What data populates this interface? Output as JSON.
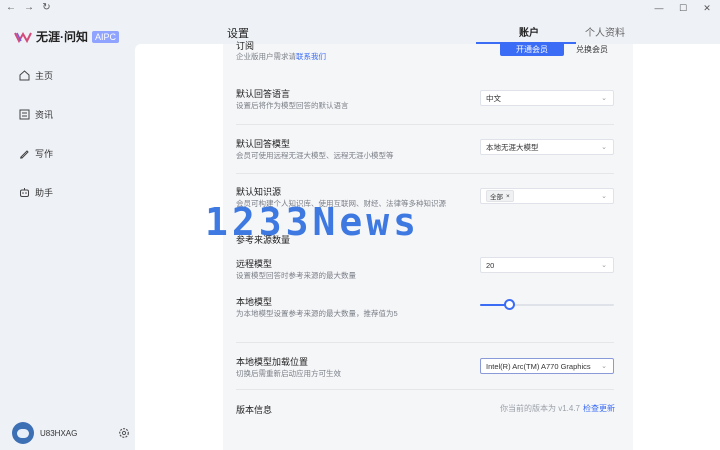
{
  "titlebar": {
    "back_icon": "arrow-left-icon",
    "forward_icon": "arrow-right-icon",
    "refresh_icon": "refresh-icon",
    "minimize": "—",
    "maximize": "☐",
    "close": "✕"
  },
  "sidebar": {
    "logo_text": "无涯·问知",
    "logo_badge": "AIPC",
    "items": [
      {
        "label": "主页",
        "icon": "home-icon"
      },
      {
        "label": "资讯",
        "icon": "news-icon"
      },
      {
        "label": "写作",
        "icon": "pen-icon"
      },
      {
        "label": "助手",
        "icon": "robot-icon"
      }
    ],
    "user": {
      "name": "U83HXAG",
      "settings_icon": "gear-icon"
    }
  },
  "header": {
    "title": "设置",
    "tabs": [
      {
        "label": "账户",
        "active": true
      },
      {
        "label": "个人资料",
        "active": false
      }
    ]
  },
  "settings": {
    "account": {
      "title_partial": "订阅",
      "desc": "企业版用户需求请",
      "link": "联系我们",
      "primary_button": "开通会员",
      "secondary_button": "兑换会员"
    },
    "answer_language": {
      "label": "默认回答语言",
      "desc": "设置后将作为模型回答的默认语言",
      "value": "中文"
    },
    "answer_model": {
      "label": "默认回答模型",
      "desc": "会员可使用远程无涯大模型、远程无涯小模型等",
      "value": "本地无涯大模型"
    },
    "knowledge_source": {
      "label": "默认知识源",
      "desc": "会员可构建个人知识库、使用互联网、财经、法律等多种知识源",
      "chip": "全部"
    },
    "reference_section": {
      "label": "参考来源数量"
    },
    "remote_model": {
      "label": "远程模型",
      "desc": "设置模型回答时参考来源的最大数量",
      "value": "20"
    },
    "local_model": {
      "label": "本地模型",
      "desc": "为本地模型设置参考来源的最大数量，推荐值为5",
      "slider_fraction": 0.22
    },
    "load_location": {
      "label": "本地模型加载位置",
      "desc": "切换后需重新启动应用方可生效",
      "value": "Intel(R) Arc(TM) A770 Graphics"
    },
    "version": {
      "label": "版本信息",
      "current": "你当前的版本为 v1.4.7",
      "check_link": "检查更新"
    }
  },
  "watermark": "1233News",
  "colors": {
    "accent": "#3b6cf6",
    "panel": "#f5f6f8",
    "sidebar": "#eef1f6"
  }
}
